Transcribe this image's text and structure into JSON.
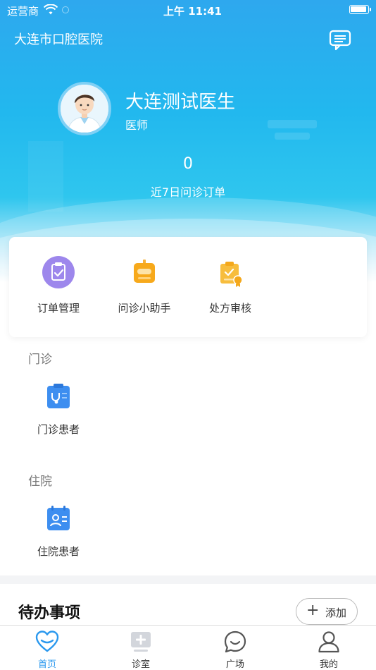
{
  "status_bar": {
    "carrier": "运营商",
    "time": "上午 11:41"
  },
  "header": {
    "hospital_name": "大连市口腔医院"
  },
  "profile": {
    "name": "大连测试医生",
    "title": "医师"
  },
  "stats": {
    "order_count": "0",
    "order_caption": "近7日问诊订单"
  },
  "tools": [
    {
      "label": "订单管理",
      "icon": "clipboard-check-icon",
      "color": "#8f7be6"
    },
    {
      "label": "问诊小助手",
      "icon": "robot-assistant-icon",
      "color": "#f5a623"
    },
    {
      "label": "处方审核",
      "icon": "prescription-review-icon",
      "color": "#f5b83a"
    }
  ],
  "outpatient": {
    "section_title": "门诊",
    "entry_label": "门诊患者",
    "icon": "stethoscope-clipboard-icon"
  },
  "inpatient": {
    "section_title": "住院",
    "entry_label": "住院患者",
    "icon": "patient-card-icon"
  },
  "todo": {
    "title": "待办事项",
    "add_label": "添加"
  },
  "tab_bar": {
    "items": [
      {
        "label": "首页",
        "icon": "heart-home-icon",
        "active": true
      },
      {
        "label": "诊室",
        "icon": "clinic-monitor-icon",
        "active": false
      },
      {
        "label": "广场",
        "icon": "chat-bubble-icon",
        "active": false
      },
      {
        "label": "我的",
        "icon": "user-profile-icon",
        "active": false
      }
    ]
  },
  "colors": {
    "accent": "#2a98ee",
    "hero_top": "#2ea8ee",
    "hero_mid": "#2fc6ee",
    "icon_blue": "#3d8ef0"
  }
}
